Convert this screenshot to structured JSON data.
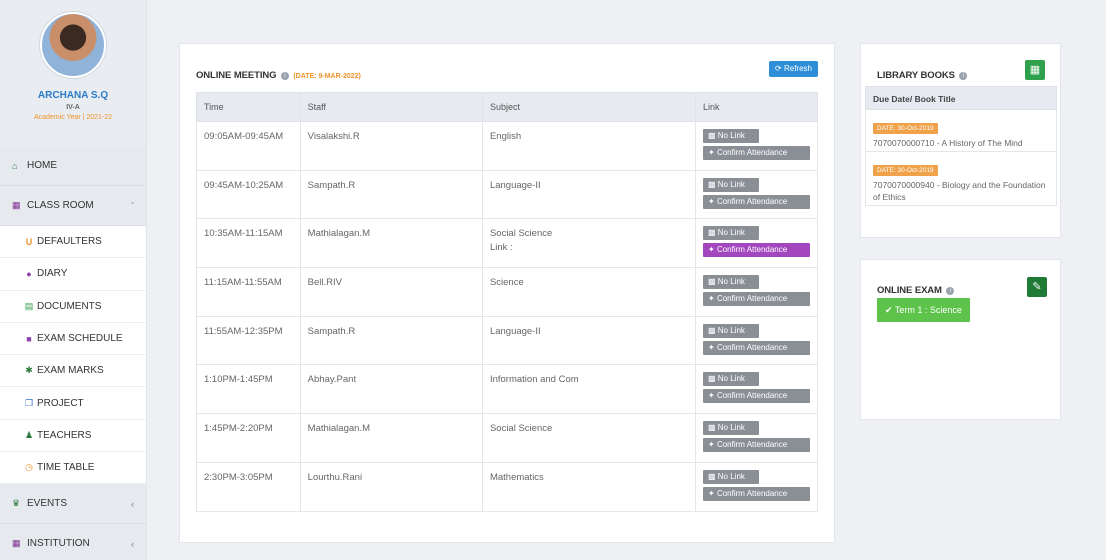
{
  "profile": {
    "name": "ARCHANA S.Q",
    "class": "IV-A",
    "year": "Academic Year | 2021-22"
  },
  "nav": {
    "home": "HOME",
    "classroom": "CLASS ROOM",
    "subitems": [
      "DEFAULTERS",
      "DIARY",
      "DOCUMENTS",
      "EXAM SCHEDULE",
      "EXAM MARKS",
      "PROJECT",
      "TEACHERS",
      "TIME TABLE"
    ],
    "events": "EVENTS",
    "institution": "INSTITUTION"
  },
  "meeting": {
    "title": "ONLINE MEETING",
    "date": "(DATE: 9-MAR-2022)",
    "refresh": "Refresh",
    "headers": [
      "Time",
      "Staff",
      "Subject",
      "Link"
    ],
    "no_link": "No Link",
    "confirm": "Confirm Attendance",
    "rows": [
      {
        "time": "09:05AM-09:45AM",
        "staff": "Visalakshi.R",
        "subject": "English",
        "subject2": ""
      },
      {
        "time": "09:45AM-10:25AM",
        "staff": "Sampath.R",
        "subject": "Language-II",
        "subject2": ""
      },
      {
        "time": "10:35AM-11:15AM",
        "staff": "Mathialagan.M",
        "subject": "Social Science",
        "subject2": "Link :"
      },
      {
        "time": "11:15AM-11:55AM",
        "staff": "Bell.RIV",
        "subject": "Science",
        "subject2": ""
      },
      {
        "time": "11:55AM-12:35PM",
        "staff": "Sampath.R",
        "subject": "Language-II",
        "subject2": ""
      },
      {
        "time": "1:10PM-1:45PM",
        "staff": "Abhay.Pant",
        "subject": "Information and Com",
        "subject2": ""
      },
      {
        "time": "1:45PM-2:20PM",
        "staff": "Mathialagan.M",
        "subject": "Social Science",
        "subject2": ""
      },
      {
        "time": "2:30PM-3:05PM",
        "staff": "Lourthu.Rani",
        "subject": "Mathematics",
        "subject2": ""
      }
    ]
  },
  "library": {
    "title": "LIBRARY BOOKS",
    "column": "Due Date/ Book Title",
    "items": [
      {
        "date": "DATE: 30-Oct-2019",
        "book": "7070070000710 - A History of The Mind"
      },
      {
        "date": "DATE: 30-Oct-2019",
        "book": "7070070000940 - Biology and the Foundation of Ethics"
      }
    ]
  },
  "exam": {
    "title": "ONLINE EXAM",
    "button": "Term 1 : Science"
  },
  "colors": {
    "accent": "#2e8fd8",
    "confirm_active": "#a347bf",
    "badge": "#f0a24a",
    "success": "#5dc34b"
  }
}
